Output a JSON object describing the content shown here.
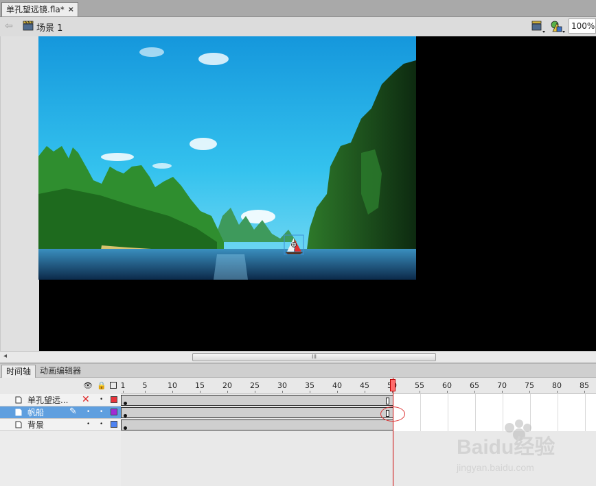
{
  "document": {
    "tab_title": "单孔望远镜.fla*",
    "close_glyph": "×"
  },
  "editbar": {
    "scene_label": "场景 1",
    "zoom_value": "100%"
  },
  "timeline": {
    "tabs": [
      "时间轴",
      "动画编辑器"
    ],
    "frame_numbers": [
      "1",
      "5",
      "10",
      "15",
      "20",
      "25",
      "30",
      "35",
      "40",
      "45",
      "50",
      "55",
      "60",
      "65",
      "70",
      "75",
      "80",
      "85"
    ],
    "current_frame": 50,
    "total_frames_span": 50,
    "layers": [
      {
        "name": "单孔望远...",
        "visible_mark": "✕",
        "lock_mark": "•",
        "color": "#e8343b",
        "selected": false
      },
      {
        "name": "帆船",
        "visible_mark": "✎",
        "lock_mark": "•",
        "color": "#a02bd5",
        "selected": true
      },
      {
        "name": "背景",
        "visible_mark": "•",
        "lock_mark": "•",
        "color": "#4f83f1",
        "selected": false
      }
    ]
  },
  "watermark": {
    "brand": "Baidu经验",
    "url": "jingyan.baidu.com"
  },
  "colors": {
    "stage_bg": "#000000",
    "sky": "#2bb5e8",
    "selection": "#5f9fdf",
    "playhead": "#cc0000"
  }
}
